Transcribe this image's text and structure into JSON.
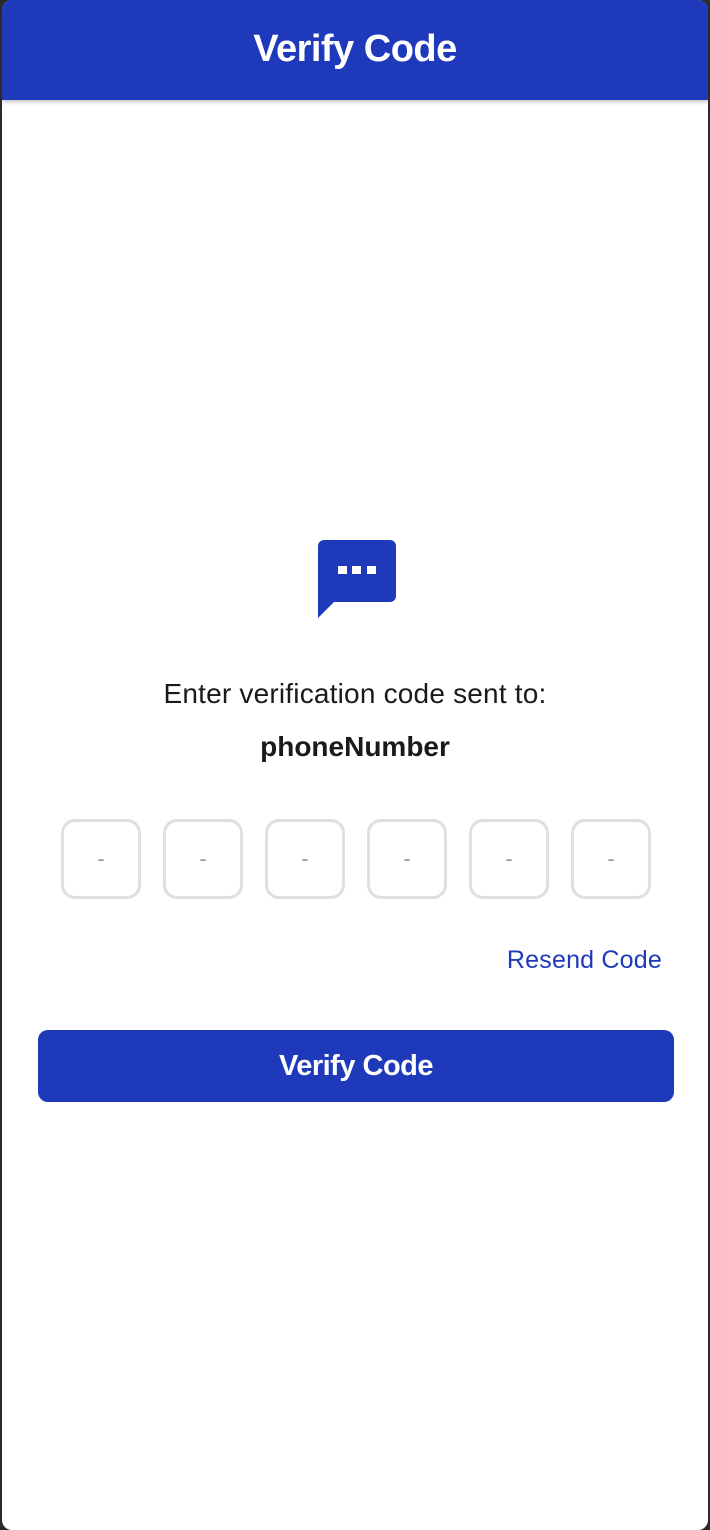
{
  "app_bar": {
    "title": "Verify Code"
  },
  "icon": {
    "name": "chat-bubble-dots-icon",
    "color": "#1e3abb"
  },
  "prompt": {
    "text": "Enter verification code sent to:",
    "phone": "phoneNumber"
  },
  "code_inputs": {
    "placeholder": "-",
    "count": 6
  },
  "resend": {
    "label": "Resend Code"
  },
  "submit": {
    "label": "Verify Code"
  },
  "colors": {
    "primary": "#1e3abb",
    "box_border": "#dedee4",
    "text": "#1a1a1a"
  }
}
